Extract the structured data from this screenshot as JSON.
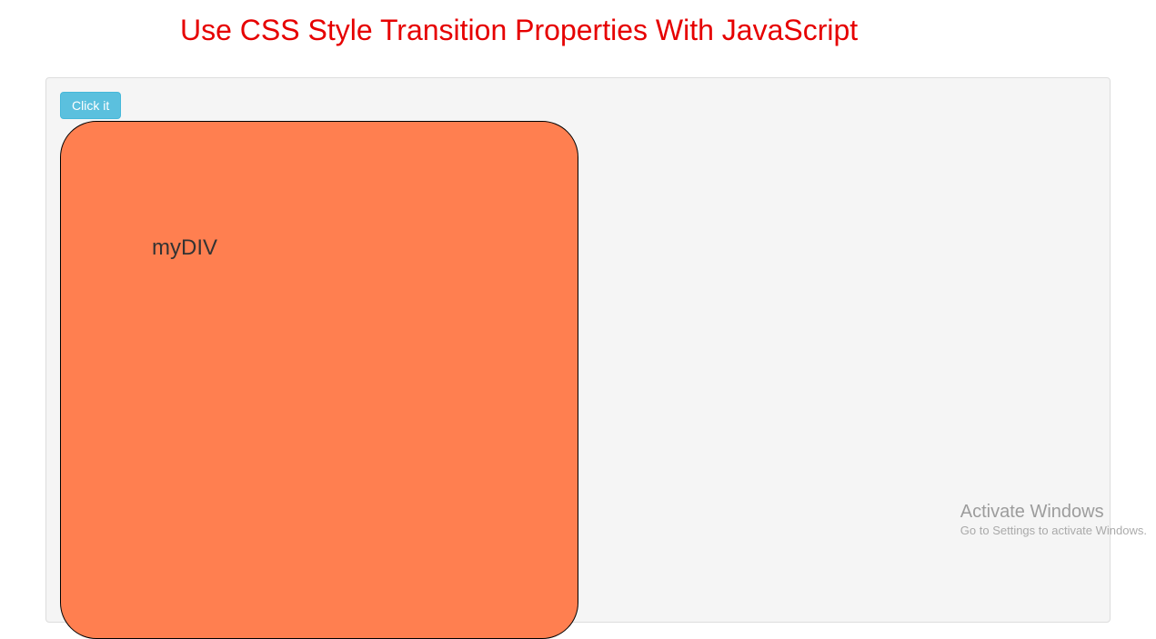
{
  "heading": "Use CSS Style Transition Properties With JavaScript",
  "button": {
    "label": "Click it"
  },
  "box": {
    "label": "myDIV"
  },
  "watermark": {
    "title": "Activate Windows",
    "subtitle": "Go to Settings to activate Windows."
  }
}
